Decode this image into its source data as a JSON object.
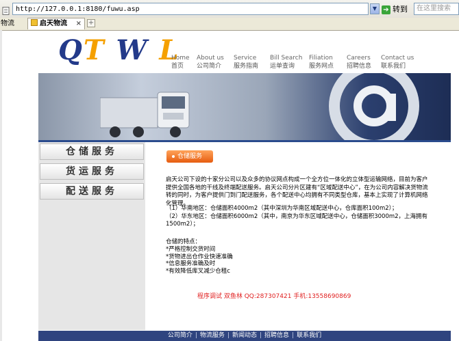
{
  "browser": {
    "url": "http://127.0.0.1:8180/fuwu.asp",
    "go_label": "转到",
    "search_placeholder": "在这里搜索",
    "tabs": [
      {
        "label": "物流"
      },
      {
        "label": "启天物流"
      }
    ],
    "close_symbol": "×",
    "newtab_symbol": "+"
  },
  "logo": {
    "q": "Q",
    "t": "T",
    "w": "W",
    "l": "L"
  },
  "nav": [
    {
      "en": "Home",
      "cn": "首页"
    },
    {
      "en": "About us",
      "cn": "公司简介"
    },
    {
      "en": "Service",
      "cn": "服务指南"
    },
    {
      "en": "Bill Search",
      "cn": "运单查询"
    },
    {
      "en": "Filiation",
      "cn": "服务网点"
    },
    {
      "en": "Careers",
      "cn": "招聘信息"
    },
    {
      "en": "Contact us",
      "cn": "联系我们"
    }
  ],
  "sidebar": [
    {
      "label": "仓储服务"
    },
    {
      "label": "货运服务"
    },
    {
      "label": "配送服务"
    }
  ],
  "content": {
    "badge": "仓储服务",
    "para1": "启天公司下设的十家分公司以及众多的协议网点构成一个全方位一体化的立体型运输网络，目前为客户提供全国各地的干线及终端配送服务。启天公司分片区建有“区域配送中心”，在为公司内容解决货物流转的同时，为客户提供门到门配送服务，各个配送中心均拥有不同类型仓库，基本上实现了计算机网络化管理。",
    "para2a": "（1）华南地区：仓储面积4000m2（其中深圳为华南区域配送中心，仓库面积100m2）；",
    "para2b": "（2）华东地区：仓储面积6000m2（其中，南京为华东区域配送中心，仓储面积3000m2，上海拥有1500m2）；",
    "features_title": "仓储的特点：",
    "features": [
      "*严格控制交货时间",
      "*货物进出仓作业快速准确",
      "*信息服务准确及时",
      "*有效降低库叉减少仓租c"
    ],
    "contact": "程序调试 双鱼林 QQ:287307421 手机:13558690869"
  },
  "footer": [
    {
      "label": "公司简介"
    },
    {
      "label": "物流服务"
    },
    {
      "label": "新闻动态"
    },
    {
      "label": "招聘信息"
    },
    {
      "label": "联系我们"
    }
  ],
  "colors": {
    "footer_bg": "#2f447f",
    "logo_blue": "#233a8a",
    "logo_orange": "#f5a000",
    "badge_orange": "#f07020",
    "contact_red": "#e02020"
  }
}
